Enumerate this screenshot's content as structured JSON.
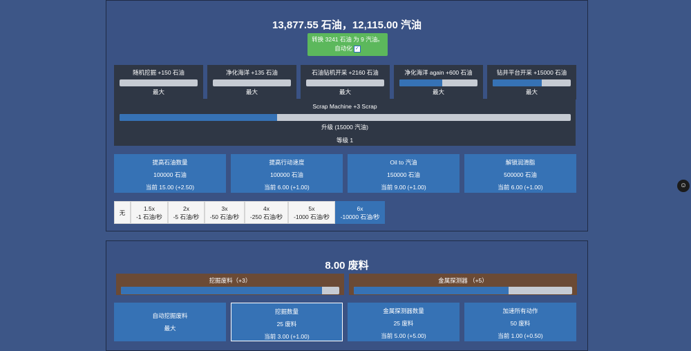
{
  "oil": {
    "totals": "13,877.55 石油，12,115.00 汽油",
    "convert": {
      "label": "转换 3241 石油 为 9 汽油。",
      "auto_label": "自动化",
      "auto_checked": true
    },
    "generators": [
      {
        "title": "随机挖掘 +150 石油",
        "progress": 0.0,
        "status": "最大"
      },
      {
        "title": "净化海洋 +135 石油",
        "progress": 0.0,
        "status": "最大"
      },
      {
        "title": "石油钻机开采 +2160 石油",
        "progress": 0.0,
        "status": "最大"
      },
      {
        "title": "净化海洋 again +600 石油",
        "progress": 0.55,
        "status": "最大"
      },
      {
        "title": "钻井平台开采 +15000 石油",
        "progress": 0.63,
        "status": "最大"
      }
    ],
    "scrap_machine": {
      "title": "Scrap Machine +3 Scrap",
      "progress": 0.35,
      "upgrade": "升级 (15000 汽油)",
      "level": "等级 1"
    },
    "upgrades": [
      {
        "title": "提高石油数量",
        "cost": "100000 石油",
        "current": "当前 15.00 (+2.50)"
      },
      {
        "title": "提高行动速度",
        "cost": "100000 石油",
        "current": "当前 6.00 (+1.00)"
      },
      {
        "title": "Oil to 汽油",
        "cost": "150000 石油",
        "current": "当前 9.00 (+1.00)"
      },
      {
        "title": "解锁润滑脂",
        "cost": "500000 石油",
        "current": "当前 6.00 (+1.00)"
      }
    ],
    "speeds": [
      {
        "mult": "无",
        "rate": ""
      },
      {
        "mult": "1.5x",
        "rate": "-1 石油/秒"
      },
      {
        "mult": "2x",
        "rate": "-5 石油/秒"
      },
      {
        "mult": "3x",
        "rate": "-50 石油/秒"
      },
      {
        "mult": "4x",
        "rate": "-250 石油/秒"
      },
      {
        "mult": "5x",
        "rate": "-1000 石油/秒"
      },
      {
        "mult": "6x",
        "rate": "-10000 石油/秒"
      }
    ],
    "active_speed": "6x"
  },
  "scrap": {
    "total": "8.00 废料",
    "generators": [
      {
        "title": "挖掘废料（+3）",
        "progress": 0.92
      },
      {
        "title": "金属探测器 （+5）",
        "progress": 0.71
      }
    ],
    "upgrades": [
      {
        "title": "自动挖掘废料",
        "cost": "",
        "current": "最大"
      },
      {
        "title": "挖掘数量",
        "cost": "25 废料",
        "current": "当前 3.00 (+1.00)"
      },
      {
        "title": "金属探测器数量",
        "cost": "25 废料",
        "current": "当前 5.00 (+5.00)"
      },
      {
        "title": "加速所有动作",
        "cost": "50 废料",
        "current": "当前 1.00 (+0.50)"
      }
    ]
  },
  "side_icon": "octocat-icon"
}
